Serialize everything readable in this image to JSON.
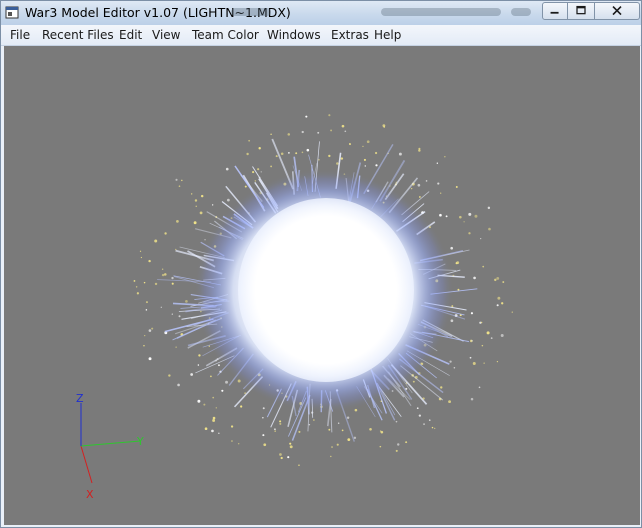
{
  "window": {
    "title": "War3 Model Editor v1.07 (LIGHTN~1.MDX)",
    "icons": {
      "app": "app-window-icon",
      "minimize": "minimize-icon",
      "maximize": "maximize-icon",
      "close": "close-icon"
    }
  },
  "menu": [
    {
      "label": "File"
    },
    {
      "label": "Recent Files"
    },
    {
      "label": "Edit"
    },
    {
      "label": "View"
    },
    {
      "label": "Team Color"
    },
    {
      "label": "Windows"
    },
    {
      "label": "Extras"
    },
    {
      "label": "Help"
    }
  ],
  "viewport": {
    "background": "#7a7a7a",
    "model": "lightning-sphere-particle-effect",
    "axes": {
      "x_label": "X",
      "y_label": "Y",
      "z_label": "Z",
      "x_color": "#d42020",
      "y_color": "#2ec72e",
      "z_color": "#2030d0"
    }
  }
}
